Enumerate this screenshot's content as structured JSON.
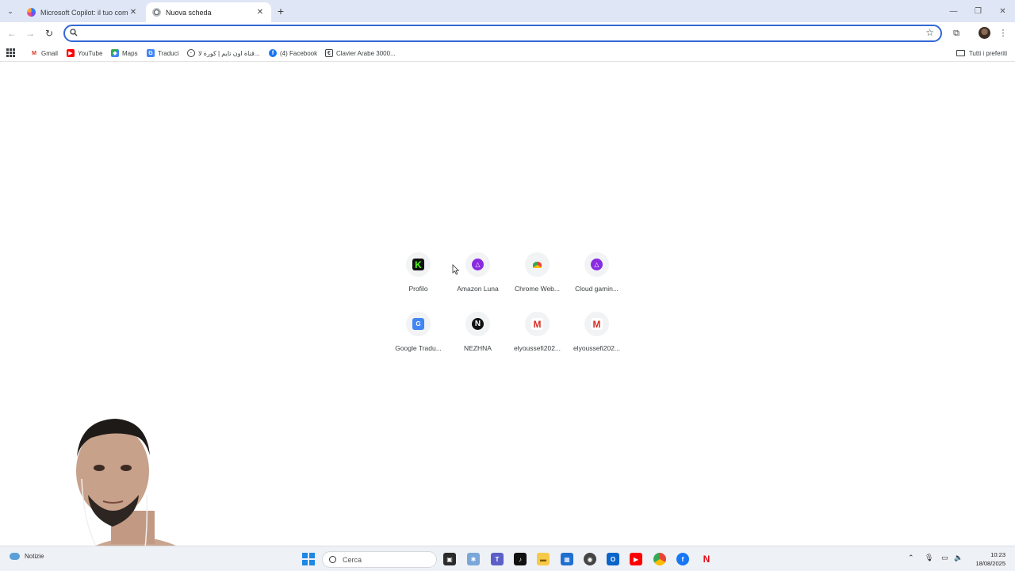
{
  "tabs": [
    {
      "title": "Microsoft Copilot: il tuo compa",
      "active": false
    },
    {
      "title": "Nuova scheda",
      "active": true
    }
  ],
  "omnibox": {
    "value": "",
    "placeholder": ""
  },
  "bookmarks": {
    "items": [
      {
        "label": "Gmail",
        "icon": "gmail-icon"
      },
      {
        "label": "YouTube",
        "icon": "youtube-icon"
      },
      {
        "label": "Maps",
        "icon": "maps-icon"
      },
      {
        "label": "Traduci",
        "icon": "translate-icon"
      },
      {
        "label": "قناة اون تايم | كورة لا...",
        "icon": "globe-icon"
      },
      {
        "label": "(4) Facebook",
        "icon": "facebook-icon"
      },
      {
        "label": "Clavier Arabe 3000...",
        "icon": "keyboard-site-icon"
      }
    ],
    "all_label": "Tutti i preferiti"
  },
  "shortcuts": [
    {
      "label": "Profilo",
      "icon": "kick-icon"
    },
    {
      "label": "Amazon Luna",
      "icon": "amazon-luna-icon"
    },
    {
      "label": "Chrome Web...",
      "icon": "chrome-web-store-icon"
    },
    {
      "label": "Cloud gamin...",
      "icon": "amazon-luna-icon"
    },
    {
      "label": "Google Tradu...",
      "icon": "google-translate-icon"
    },
    {
      "label": "NEZHNA",
      "icon": "nezhna-icon"
    },
    {
      "label": "elyoussefi202...",
      "icon": "gmail-icon"
    },
    {
      "label": "elyoussefi202...",
      "icon": "gmail-icon"
    }
  ],
  "taskbar": {
    "news_label": "Notizie",
    "search_placeholder": "Cerca",
    "time": "10:23",
    "date": "18/08/2025"
  },
  "colors": {
    "accent": "#3367d6",
    "tabstrip": "#dfe6f5",
    "taskbar": "#eef1f6"
  }
}
